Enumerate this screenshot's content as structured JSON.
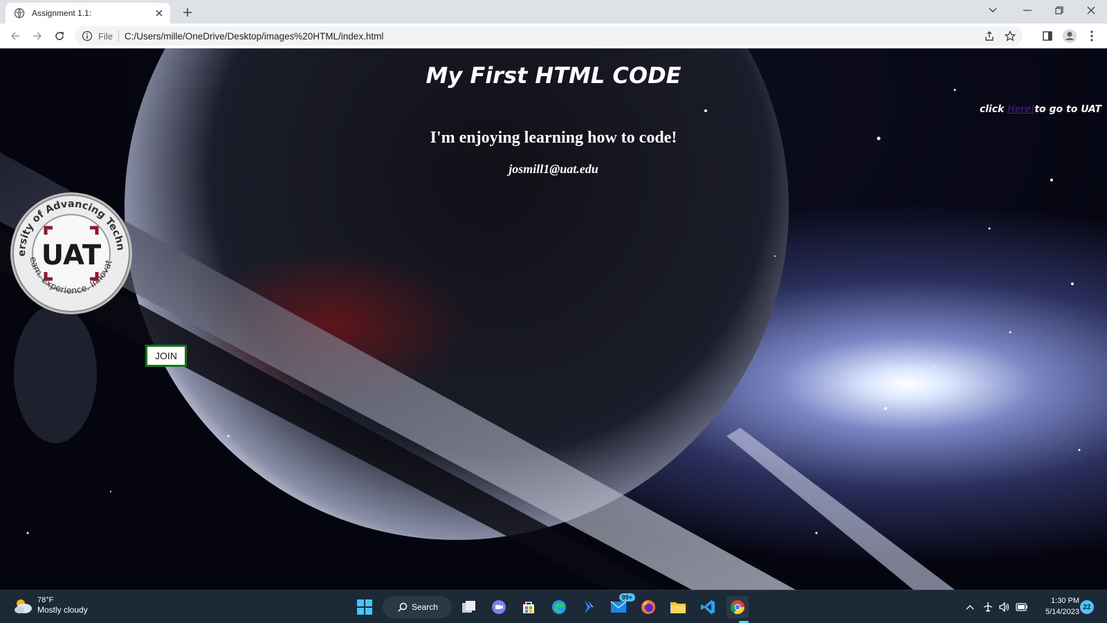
{
  "browser": {
    "tab": {
      "title": "Assignment 1.1:"
    },
    "address": {
      "scheme_label": "File",
      "url": "C:/Users/mille/OneDrive/Desktop/images%20HTML/index.html"
    }
  },
  "page": {
    "heading": "My First HTML CODE",
    "uat_prefix": "click ",
    "uat_link_text": "Here!",
    "uat_suffix": "to go to UAT",
    "subheading": "I'm enjoying learning how to code!",
    "email": "josmill1@uat.edu",
    "logo": {
      "top_text": "University of Advancing Technology",
      "bottom_text": "Learn. Experience. Innovate.",
      "center": "UAT"
    },
    "join_label": "JOIN"
  },
  "taskbar": {
    "weather": {
      "temp": "78°F",
      "desc": "Mostly cloudy"
    },
    "search_label": "Search",
    "mail_badge": "99+",
    "clock": {
      "time": "1:30 PM",
      "date": "5/14/2023"
    },
    "notification_count": "22"
  },
  "colors": {
    "accent_blue": "#60cdff",
    "join_border": "#0e7a14",
    "link_visited": "#551a8b"
  }
}
